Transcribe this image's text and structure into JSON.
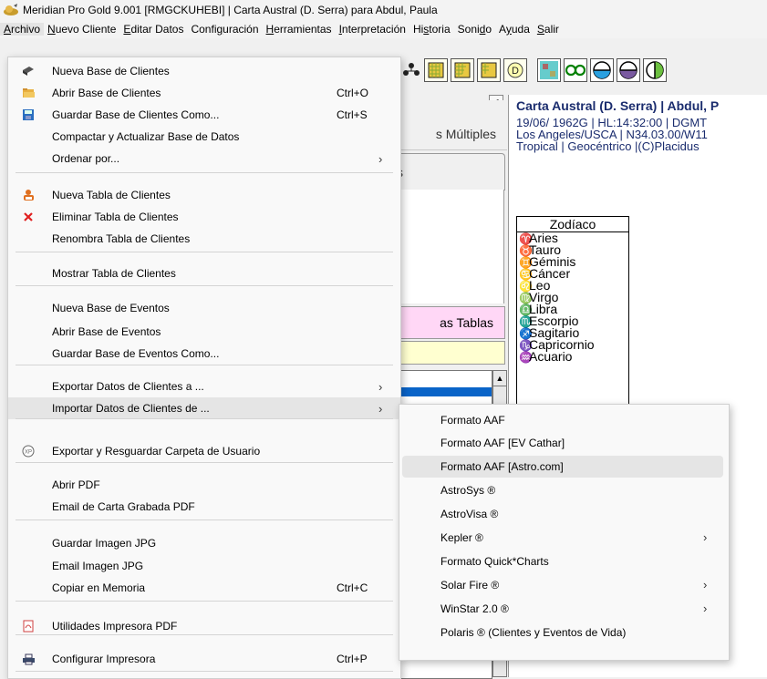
{
  "window": {
    "title": "Meridian Pro Gold 9.001 [RMGCKUHEBI] | Carta Austral (D. Serra) para Abdul, Paula"
  },
  "menubar": [
    {
      "pre": "",
      "u": "A",
      "post": "rchivo"
    },
    {
      "pre": "",
      "u": "N",
      "post": "uevo Cliente"
    },
    {
      "pre": "",
      "u": "E",
      "post": "ditar Datos"
    },
    {
      "pre": "Confi",
      "u": "g",
      "post": "uración"
    },
    {
      "pre": "",
      "u": "H",
      "post": "erramientas"
    },
    {
      "pre": "",
      "u": "I",
      "post": "nterpretación"
    },
    {
      "pre": "Hi",
      "u": "s",
      "post": "toria"
    },
    {
      "pre": "Soni",
      "u": "d",
      "post": "o"
    },
    {
      "pre": "A",
      "u": "y",
      "post": "uda"
    },
    {
      "pre": "",
      "u": "S",
      "post": "alir"
    }
  ],
  "left_panel": {
    "tab1": "s Múltiples",
    "tab2": "s",
    "pink_button": "as Tablas"
  },
  "chart": {
    "title": "Carta Austral (D. Serra) | Abdul, P",
    "line1": "19/06/ 1962G | HL:14:32:00 | DGMT",
    "line2": "Los Angeles/USCA | N34.03.00/W11",
    "line3": "Tropical | Geocéntrico |(C)Placidus"
  },
  "zodiac": {
    "title": "Zodíaco",
    "signs": [
      {
        "sym": "♈",
        "name": "Aries",
        "color": "#e00000"
      },
      {
        "sym": "♉",
        "name": "Tauro",
        "color": "#008000"
      },
      {
        "sym": "♊",
        "name": "Géminis",
        "color": "#c8a000"
      },
      {
        "sym": "♋",
        "name": "Cáncer",
        "color": "#0050c0"
      },
      {
        "sym": "♌",
        "name": "Leo",
        "color": "#e00000"
      },
      {
        "sym": "♍",
        "name": "Virgo",
        "color": "#008000"
      },
      {
        "sym": "♎",
        "name": "Libra",
        "color": "#c8a000"
      },
      {
        "sym": "♏",
        "name": "Escorpio",
        "color": "#0050c0"
      },
      {
        "sym": "♐",
        "name": "Sagitario",
        "color": "#e00000"
      },
      {
        "sym": "♑",
        "name": "Capricornio",
        "color": "#008000"
      },
      {
        "sym": "♒",
        "name": "Acuario",
        "color": "#c8a000"
      }
    ]
  },
  "archivo_menu": {
    "items": [
      {
        "label": "Nueva Base de Clientes",
        "shortcut": "",
        "icon": "database-icon"
      },
      {
        "label": "Abrir Base de Clientes",
        "shortcut": "Ctrl+O",
        "icon": "folder-open-icon"
      },
      {
        "label": "Guardar Base de Clientes Como...",
        "shortcut": "Ctrl+S",
        "icon": "save-icon"
      },
      {
        "label": "Compactar y Actualizar Base de Datos",
        "shortcut": ""
      },
      {
        "label": "Ordenar por...",
        "shortcut": "",
        "submenu": true
      },
      {
        "label": "Nueva Tabla de Clientes",
        "shortcut": "",
        "icon": "new-table-icon"
      },
      {
        "label": "Eliminar Tabla de Clientes",
        "shortcut": "",
        "icon": "delete-icon"
      },
      {
        "label": "Renombra Tabla de Clientes",
        "shortcut": ""
      },
      {
        "label": "Mostrar Tabla de Clientes",
        "shortcut": ""
      },
      {
        "label": "Nueva Base de Eventos",
        "shortcut": ""
      },
      {
        "label": "Abrir Base de Eventos",
        "shortcut": ""
      },
      {
        "label": "Guardar Base de Eventos Como...",
        "shortcut": ""
      },
      {
        "label": "Exportar Datos de Clientes a ...",
        "shortcut": "",
        "submenu": true
      },
      {
        "label": "Importar Datos de Clientes de ...",
        "shortcut": "",
        "submenu": true,
        "highlighted": true
      },
      {
        "label": "Exportar y Resguardar Carpeta de Usuario",
        "shortcut": "",
        "icon": "backup-icon"
      },
      {
        "label": "Abrir PDF",
        "shortcut": ""
      },
      {
        "label": "Email de Carta Grabada PDF",
        "shortcut": ""
      },
      {
        "label": "Guardar Imagen JPG",
        "shortcut": ""
      },
      {
        "label": "Email Imagen JPG",
        "shortcut": ""
      },
      {
        "label": "Copiar en Memoria",
        "shortcut": "Ctrl+C"
      },
      {
        "label": "Utilidades Impresora PDF",
        "shortcut": "",
        "icon": "pdf-icon"
      },
      {
        "label": "Configurar Impresora",
        "shortcut": "Ctrl+P",
        "icon": "printer-icon"
      }
    ]
  },
  "import_submenu": {
    "items": [
      {
        "label": "Formato AAF"
      },
      {
        "label": "Formato AAF [EV Cathar]"
      },
      {
        "label": "Formato AAF [Astro.com]",
        "highlighted": true
      },
      {
        "label": "AstroSys ®"
      },
      {
        "label": "AstroVisa ®"
      },
      {
        "label": "Kepler ®",
        "submenu": true
      },
      {
        "label": "Formato Quick*Charts"
      },
      {
        "label": "Solar Fire ®",
        "submenu": true
      },
      {
        "label": "WinStar 2.0 ®",
        "submenu": true
      },
      {
        "label": "Polaris ® (Clientes y Eventos de Vida)"
      }
    ]
  },
  "colors": {
    "chart_text": "#1a2c6e",
    "pink_panel": "#ffd7f6",
    "yellow_panel": "#ffffd0",
    "selection": "#0a64c8"
  }
}
